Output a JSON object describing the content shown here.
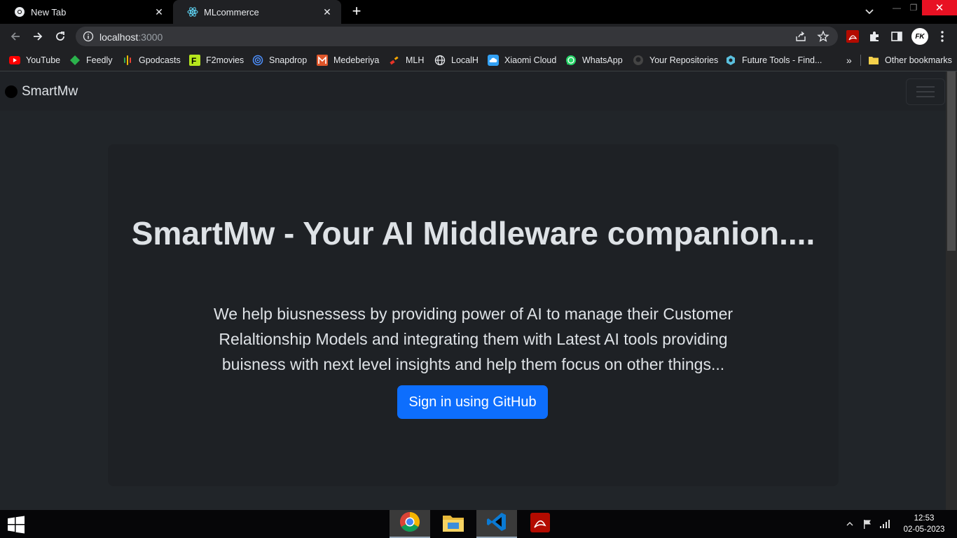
{
  "browser": {
    "tabs": [
      {
        "title": "New Tab",
        "active": false,
        "icon": "chrome-icon"
      },
      {
        "title": "MLcommerce",
        "active": true,
        "icon": "react-icon"
      }
    ],
    "address": {
      "host": "localhost",
      "port": ":3000"
    },
    "profile_initials": "FK",
    "bookmarks": [
      {
        "label": "YouTube",
        "icon": "youtube-icon",
        "color": "#ff0000"
      },
      {
        "label": "Feedly",
        "icon": "feedly-icon",
        "color": "#2bb24c"
      },
      {
        "label": "Gpodcasts",
        "icon": "google-podcasts-icon",
        "color": "#fbbc04"
      },
      {
        "label": "F2movies",
        "icon": "f2movies-icon",
        "color": "#b5e61d"
      },
      {
        "label": "Snapdrop",
        "icon": "snapdrop-icon",
        "color": "#4d90fe"
      },
      {
        "label": "Medeberiya",
        "icon": "medeberiya-icon",
        "color": "#e0562a"
      },
      {
        "label": "MLH",
        "icon": "mlh-icon",
        "color": "#e73427"
      },
      {
        "label": "LocalH",
        "icon": "globe-icon",
        "color": "#e8eaed"
      },
      {
        "label": "Xiaomi Cloud",
        "icon": "xiaomi-cloud-icon",
        "color": "#33a1f4"
      },
      {
        "label": "WhatsApp",
        "icon": "whatsapp-icon",
        "color": "#25d366"
      },
      {
        "label": "Your Repositories",
        "icon": "github-icon",
        "color": "#444444"
      },
      {
        "label": "Future Tools - Find...",
        "icon": "future-tools-icon",
        "color": "#5bc0de"
      }
    ],
    "overflow_label": "»",
    "other_bookmarks": "Other bookmarks"
  },
  "page": {
    "brand": "SmartMw",
    "hero": {
      "title": "SmartMw - Your AI Middleware companion....",
      "description": "We help biusnessess by providing power of AI to manage their Customer Relaltionship Models and integrating them with Latest AI tools providing buisness with next level insights and help them focus on other things...",
      "button_label": "Sign in using GitHub"
    }
  },
  "taskbar": {
    "time": "12:53",
    "date": "02-05-2023"
  },
  "colors": {
    "page_bg": "#212529",
    "hero_bg": "#1e2125",
    "primary_button": "#0d6efd",
    "close_button": "#e81123"
  }
}
